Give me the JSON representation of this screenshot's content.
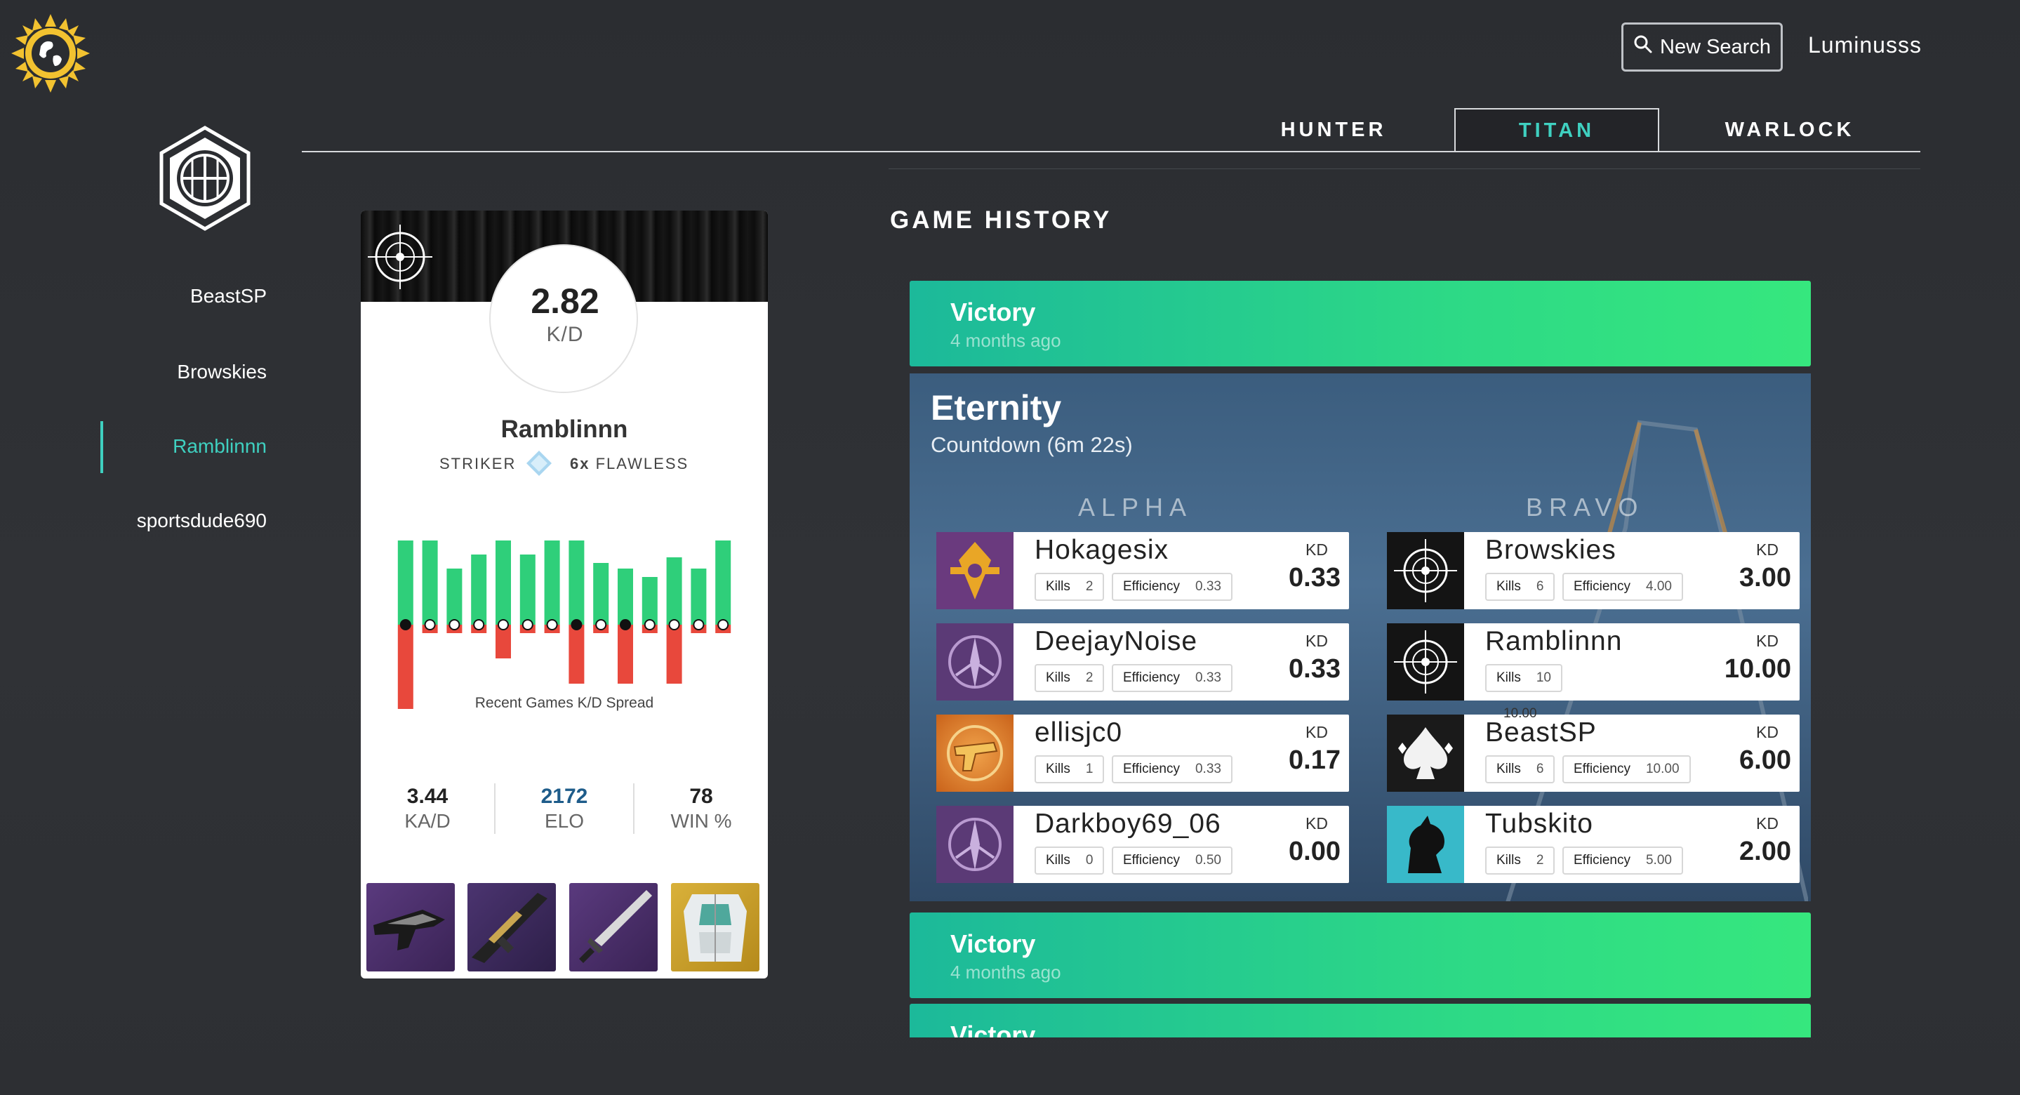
{
  "header": {
    "new_search_label": "New Search",
    "username": "Luminusss"
  },
  "tabs": [
    {
      "label": "HUNTER"
    },
    {
      "label": "TITAN"
    },
    {
      "label": "WARLOCK"
    }
  ],
  "active_tab": "TITAN",
  "accent_color": "#3fd0c0",
  "sidebar": {
    "items": [
      {
        "label": "BeastSP"
      },
      {
        "label": "Browskies"
      },
      {
        "label": "Ramblinnn"
      },
      {
        "label": "sportsdude690"
      }
    ],
    "active_item": "Ramblinnn"
  },
  "card": {
    "kd_value": "2.82",
    "kd_label": "K/D",
    "name": "Ramblinnn",
    "subclass": "STRIKER",
    "flawless_count": "6x",
    "flawless_label": "FLAWLESS",
    "spread_label": "Recent Games K/D Spread",
    "spread": {
      "positive": [
        3,
        3,
        2,
        2.5,
        3,
        2.5,
        3,
        3,
        2.2,
        2,
        1.7,
        2.4,
        2,
        3
      ],
      "negative": [
        3,
        0.3,
        0.3,
        0.3,
        1.2,
        0.3,
        0.3,
        2.1,
        0.3,
        2.1,
        0.3,
        2.1,
        0.3,
        0.3
      ],
      "markers": [
        "filled",
        "open",
        "open",
        "open",
        "open",
        "open",
        "open",
        "filled",
        "open",
        "filled",
        "open",
        "open",
        "open",
        "open"
      ]
    },
    "stats": [
      {
        "value": "3.44",
        "label": "KA/D",
        "color": "#222222"
      },
      {
        "value": "2172",
        "label": "ELO",
        "color": "#1e5c8a"
      },
      {
        "value": "78",
        "label": "WIN %",
        "color": "#222222"
      }
    ],
    "loadout": [
      {
        "name": "auto-rifle-icon"
      },
      {
        "name": "sniper-rifle-icon"
      },
      {
        "name": "sword-icon"
      },
      {
        "name": "chest-armor-icon"
      }
    ]
  },
  "game_history": {
    "title": "GAME HISTORY",
    "games": [
      {
        "result": "Victory",
        "time": "4 months ago"
      },
      {
        "result": "Victory",
        "time": "4 months ago"
      },
      {
        "result": "Victory",
        "time": ""
      }
    ],
    "expanded_match": {
      "map": "Eternity",
      "mode": "Countdown (6m 22s)",
      "kd_label": "KD",
      "kills_label": "Kills",
      "efficiency_label": "Efficiency",
      "teams": [
        {
          "name": "ALPHA",
          "players": [
            {
              "name": "Hokagesix",
              "kills": "2",
              "efficiency": "0.33",
              "kd": "0.33",
              "emblem": "gold-diamond-emblem-icon"
            },
            {
              "name": "DeejayNoise",
              "kills": "2",
              "efficiency": "0.33",
              "kd": "0.33",
              "emblem": "purple-warlock-emblem-icon"
            },
            {
              "name": "ellisjc0",
              "kills": "1",
              "efficiency": "0.33",
              "kd": "0.17",
              "emblem": "golden-gun-emblem-icon"
            },
            {
              "name": "Darkboy69_06",
              "kills": "0",
              "efficiency": "0.50",
              "kd": "0.00",
              "emblem": "purple-warlock-emblem-icon"
            }
          ]
        },
        {
          "name": "BRAVO",
          "players": [
            {
              "name": "Browskies",
              "kills": "6",
              "efficiency": "4.00",
              "kd": "3.00",
              "emblem": "crosshair-emblem-icon"
            },
            {
              "name": "Ramblinnn",
              "kills": "10",
              "efficiency": "",
              "kd": "10.00",
              "emblem": "crosshair-emblem-icon"
            },
            {
              "name": "BeastSP",
              "kills": "6",
              "efficiency": "10.00",
              "kd": "6.00",
              "emblem": "spade-emblem-icon"
            },
            {
              "name": "Tubskito",
              "kills": "2",
              "efficiency": "5.00",
              "kd": "2.00",
              "emblem": "horse-emblem-icon"
            }
          ]
        }
      ],
      "tooltip_value": "10.00"
    }
  }
}
